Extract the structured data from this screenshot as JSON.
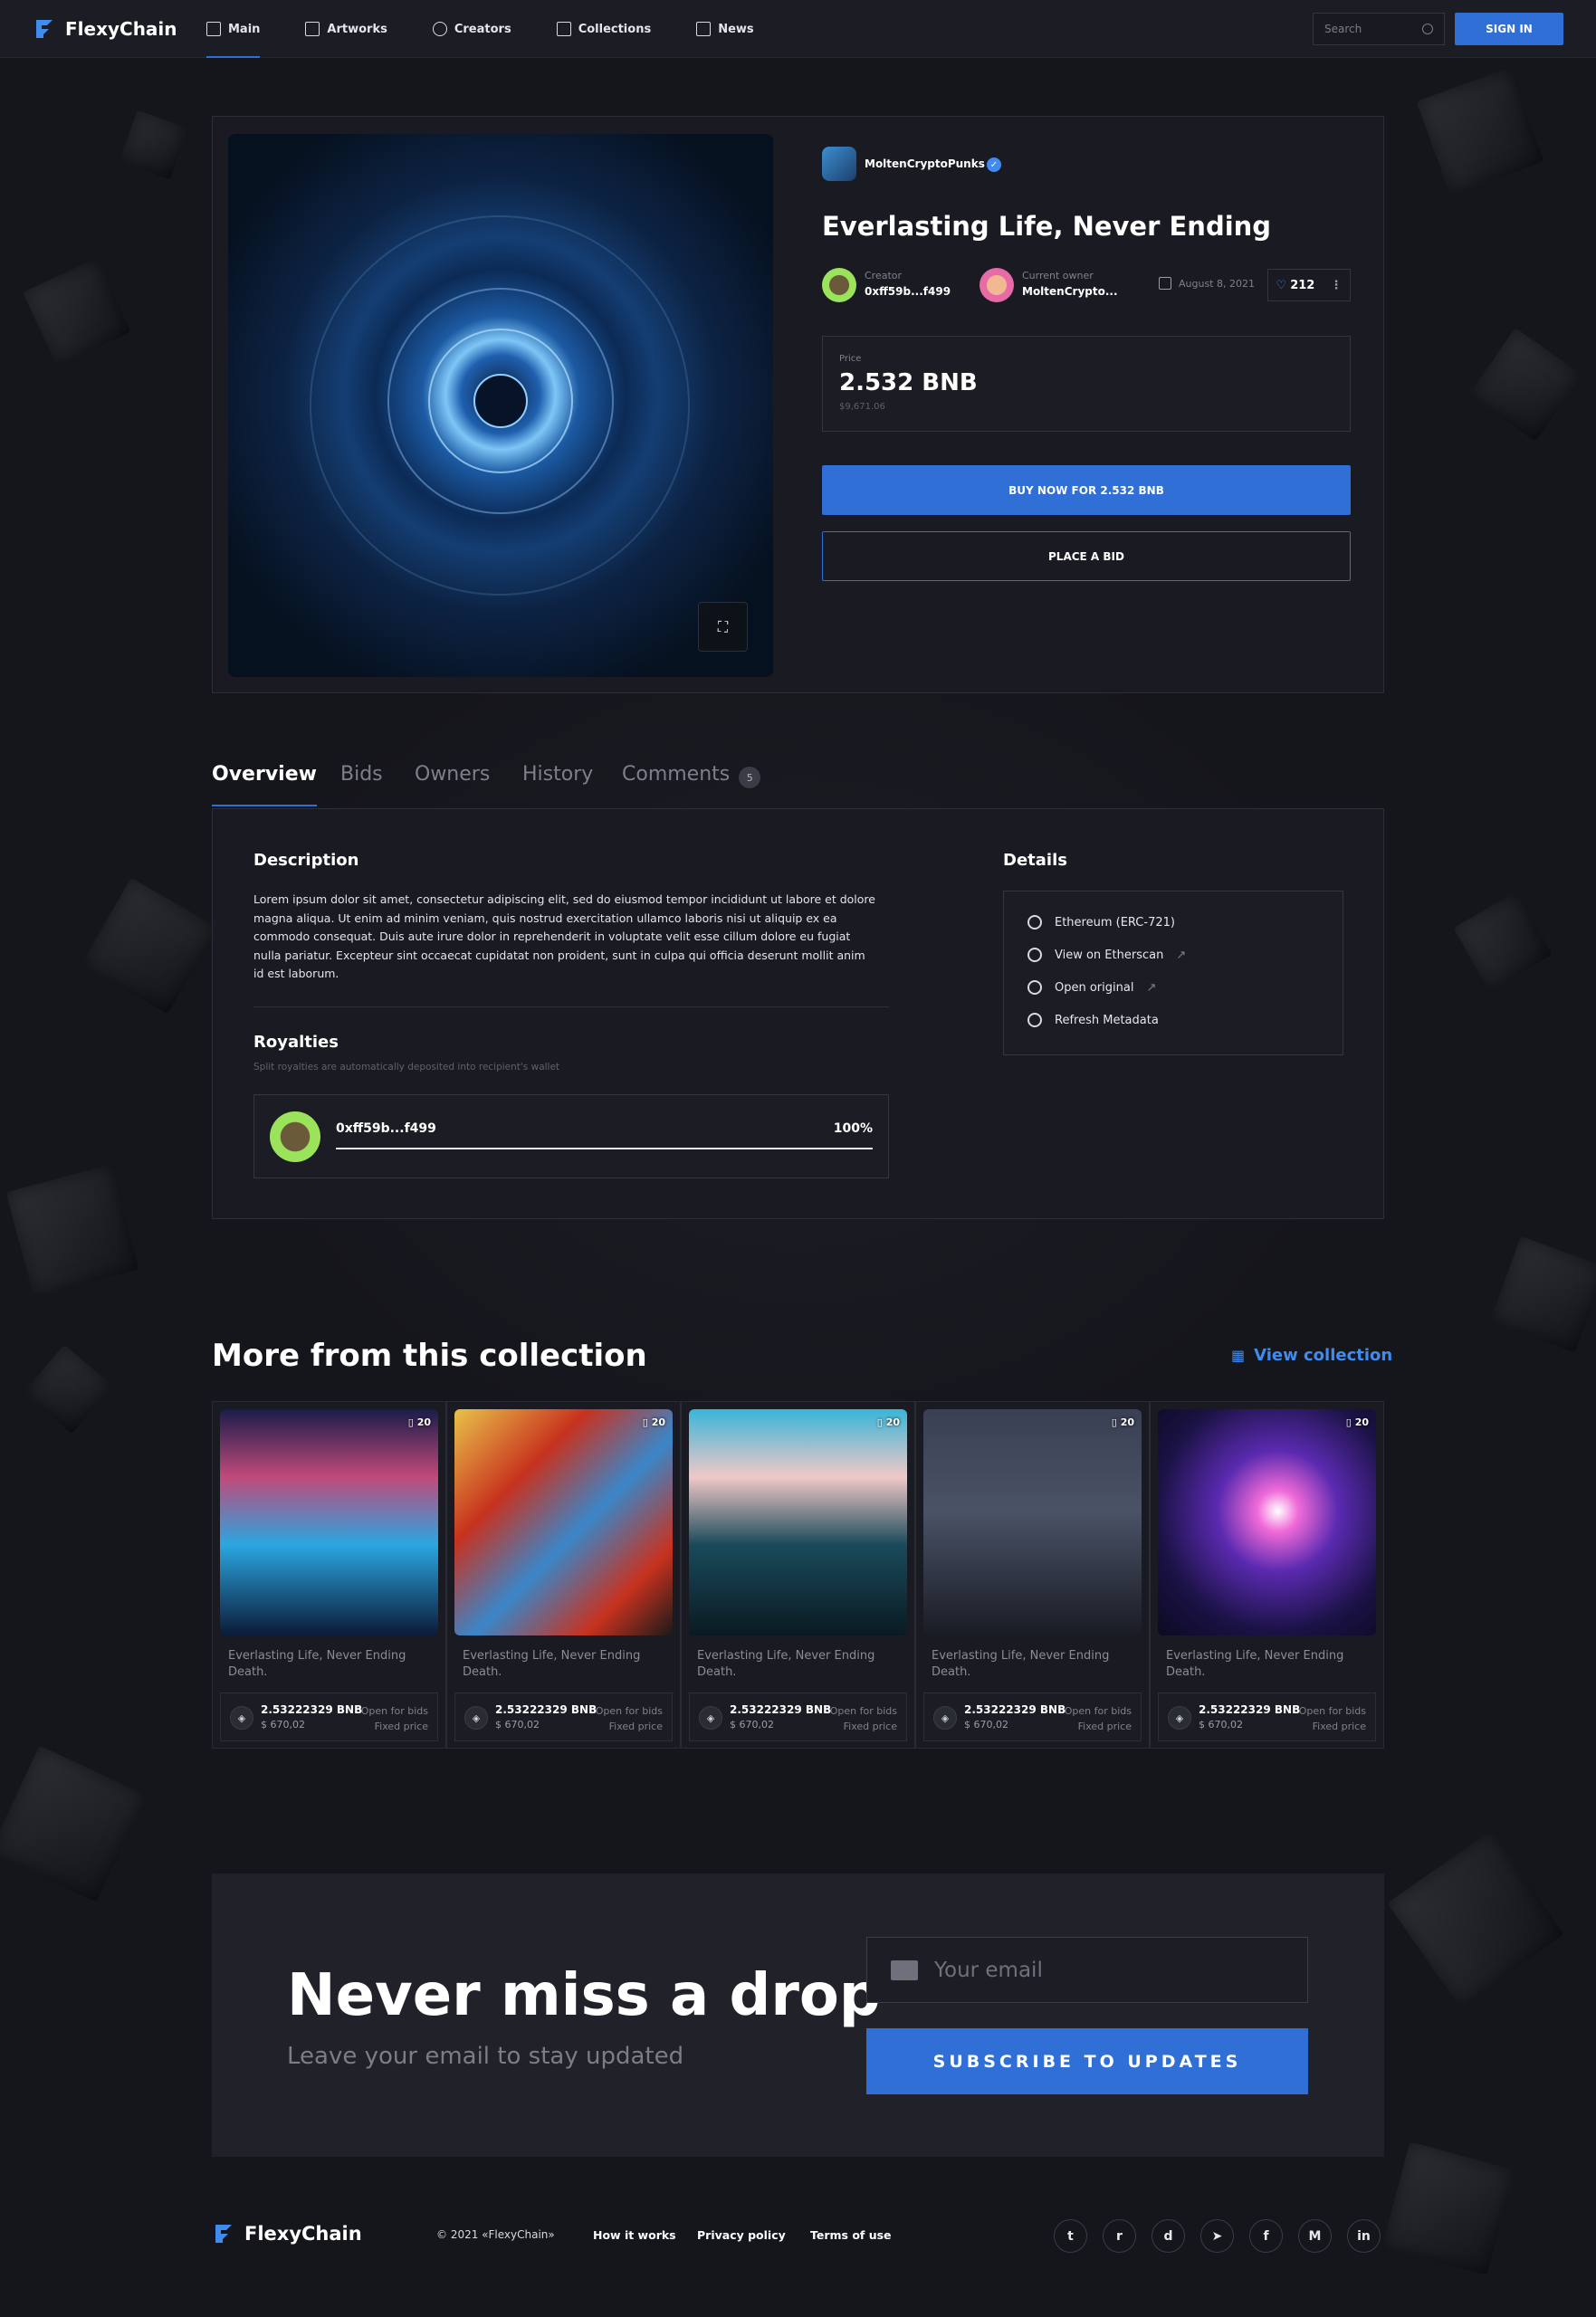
{
  "header": {
    "brand": "FlexyChain",
    "nav": [
      {
        "label": "Main",
        "icon": "home-icon"
      },
      {
        "label": "Artworks",
        "icon": "image-icon"
      },
      {
        "label": "Creators",
        "icon": "users-icon"
      },
      {
        "label": "Collections",
        "icon": "grid-icon"
      },
      {
        "label": "News",
        "icon": "newspaper-icon"
      }
    ],
    "search_placeholder": "Search",
    "signin_label": "SIGN IN"
  },
  "item": {
    "collection": "MoltenCryptoPunks",
    "title": "Everlasting Life, Never Ending",
    "creator_label": "Creator",
    "creator": "0xff59b...f499",
    "owner_label": "Current owner",
    "owner": "MoltenCrypto...",
    "date": "August 8, 2021",
    "likes": "212",
    "price_label": "Price",
    "price": "2.532 BNB",
    "price_usd": "$9,671.06",
    "buy_label": "BUY NOW FOR 2.532 BNB",
    "bid_label": "PLACE A BID"
  },
  "tabs": [
    {
      "label": "Overview"
    },
    {
      "label": "Bids"
    },
    {
      "label": "Owners"
    },
    {
      "label": "History"
    },
    {
      "label": "Comments",
      "count": "5"
    }
  ],
  "overview": {
    "description_title": "Description",
    "description": "Lorem ipsum dolor sit amet, consectetur adipiscing elit, sed do eiusmod tempor incididunt ut labore et dolore magna aliqua. Ut enim ad minim veniam, quis nostrud exercitation ullamco laboris nisi ut aliquip ex ea commodo consequat. Duis aute irure dolor in reprehenderit in voluptate velit esse cillum dolore eu fugiat nulla pariatur. Excepteur sint occaecat cupidatat non proident, sunt in culpa qui officia deserunt mollit anim id est laborum.",
    "royalties_title": "Royalties",
    "royalties_subtitle": "Split royalties are automatically deposited into recipient's wallet",
    "royalty_address": "0xff59b...f499",
    "royalty_percent": "100%",
    "royalty_fraction": 1.0,
    "details_title": "Details",
    "details": [
      {
        "label": "Ethereum (ERC-721)",
        "icon": "ethereum-icon",
        "external": false
      },
      {
        "label": "View on Etherscan",
        "icon": "etherscan-icon",
        "external": true
      },
      {
        "label": "Open original",
        "icon": "eye-icon",
        "external": true
      },
      {
        "label": "Refresh Metadata",
        "icon": "refresh-icon",
        "external": false
      }
    ]
  },
  "more": {
    "title": "More from this collection",
    "view_label": "View collection",
    "cards": [
      {
        "count": "20",
        "name": "Everlasting Life, Never Ending Death.",
        "price": "2.53222329 BNB",
        "usd": "$ 670,02",
        "status1": "Open for bids",
        "status2": "Fixed price"
      },
      {
        "count": "20",
        "name": "Everlasting Life, Never Ending Death.",
        "price": "2.53222329 BNB",
        "usd": "$ 670,02",
        "status1": "Open for bids",
        "status2": "Fixed price"
      },
      {
        "count": "20",
        "name": "Everlasting Life, Never Ending Death.",
        "price": "2.53222329 BNB",
        "usd": "$ 670,02",
        "status1": "Open for bids",
        "status2": "Fixed price"
      },
      {
        "count": "20",
        "name": "Everlasting Life, Never Ending Death.",
        "price": "2.53222329 BNB",
        "usd": "$ 670,02",
        "status1": "Open for bids",
        "status2": "Fixed price"
      },
      {
        "count": "20",
        "name": "Everlasting Life, Never Ending Death.",
        "price": "2.53222329 BNB",
        "usd": "$ 670,02",
        "status1": "Open for bids",
        "status2": "Fixed price"
      }
    ]
  },
  "newsletter": {
    "title": "Never miss a drop",
    "subtitle": "Leave your email to stay updated",
    "email_placeholder": "Your email",
    "button_label": "SUBSCRIBE TO UPDATES"
  },
  "footer": {
    "brand": "FlexyChain",
    "copyright": "© 2021 «FlexyChain»",
    "links": [
      "How it works",
      "Privacy policy",
      "Terms of use"
    ],
    "socials": [
      {
        "icon": "twitter-icon",
        "glyph": "t"
      },
      {
        "icon": "reddit-icon",
        "glyph": "r"
      },
      {
        "icon": "discord-icon",
        "glyph": "d"
      },
      {
        "icon": "telegram-icon",
        "glyph": "➤"
      },
      {
        "icon": "facebook-icon",
        "glyph": "f"
      },
      {
        "icon": "medium-icon",
        "glyph": "M"
      },
      {
        "icon": "linkedin-icon",
        "glyph": "in"
      }
    ]
  },
  "colors": {
    "accent": "#2f6fd6",
    "background": "#16171d",
    "card": "#1a1b22"
  }
}
